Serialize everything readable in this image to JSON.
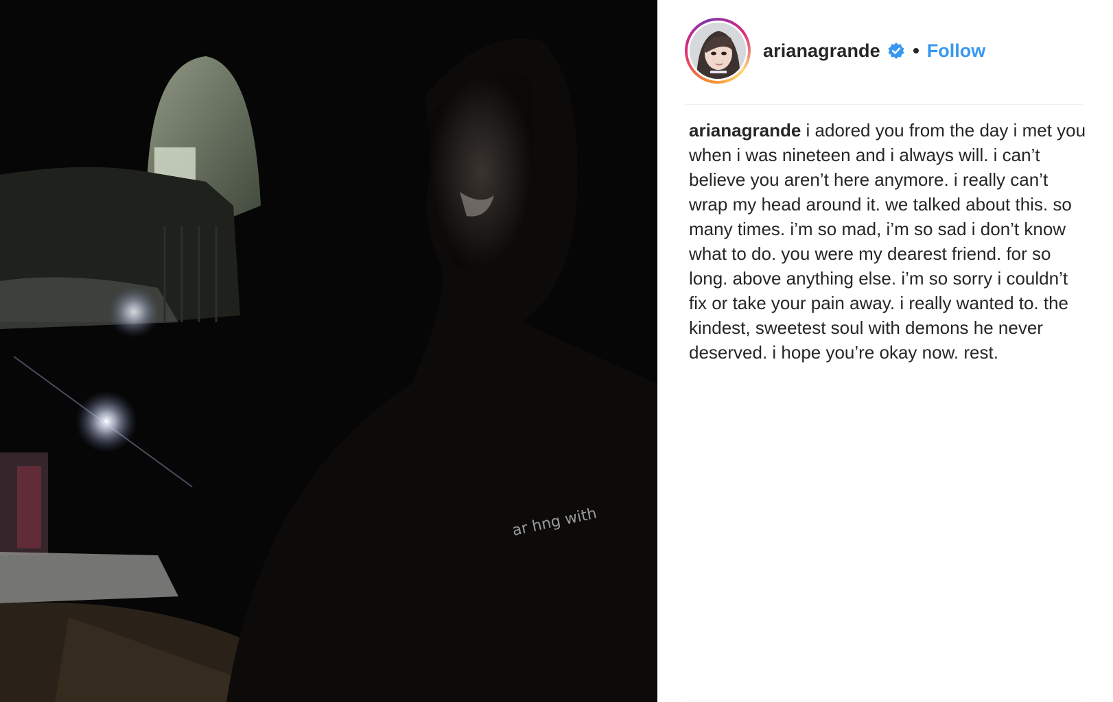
{
  "post": {
    "username": "arianagrande",
    "separator": "•",
    "follow_label": "Follow",
    "caption_username": "arianagrande",
    "caption_text": "i adored you from the day i met you when i was nineteen and i always will. i can’t believe you aren’t here anymore. i really can’t wrap my head around it. we talked about this. so many times. i’m so mad, i’m so sad i don’t know what to do. you were my dearest friend. for so long. above anything else. i’m so sorry i couldn’t fix or take your pain away. i really wanted to. the kindest, sweetest soul with demons he never deserved. i hope you’re okay now. rest.",
    "media_overlay_text": "ar hng with"
  },
  "icons": {
    "verified": "verified-badge-icon",
    "avatar": "profile-avatar"
  },
  "colors": {
    "follow": "#3897f0",
    "text": "#262626",
    "divider": "#efefef",
    "verified": "#3897f0"
  }
}
